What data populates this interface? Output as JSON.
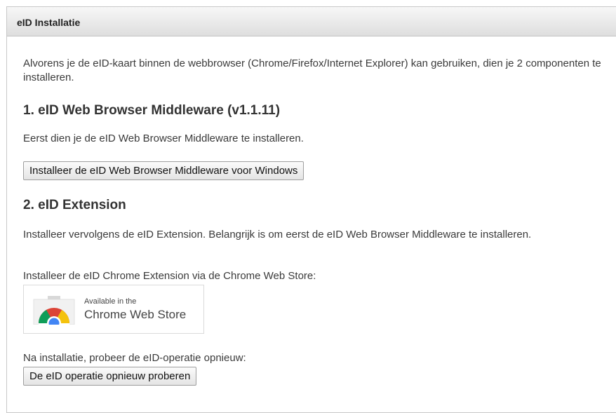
{
  "panel": {
    "title": "eID Installatie"
  },
  "intro": "Alvorens je de eID-kaart binnen de webbrowser (Chrome/Firefox/Internet Explorer) kan gebruiken, dien je 2 componenten te installeren.",
  "section1": {
    "heading": "1. eID Web Browser Middleware (v1.1.11)",
    "text": "Eerst dien je de eID Web Browser Middleware te installeren.",
    "button_label": "Installeer de eID Web Browser Middleware voor Windows"
  },
  "section2": {
    "heading": "2. eID Extension",
    "text": "Installeer vervolgens de eID Extension. Belangrijk is om eerst de eID Web Browser Middleware te installeren.",
    "store_text": "Installeer de eID Chrome Extension via de Chrome Web Store:",
    "badge": {
      "line1": "Available in the",
      "line2": "Chrome Web Store",
      "icon": "chrome-web-store-icon"
    }
  },
  "retry": {
    "text": "Na installatie, probeer de eID-operatie opnieuw:",
    "button_label": "De eID operatie opnieuw proberen"
  },
  "colors": {
    "header_gradient_top": "#f7f7f7",
    "header_gradient_bottom": "#dedede",
    "chrome_red": "#db4437",
    "chrome_yellow": "#f4c20d",
    "chrome_green": "#0f9d58",
    "chrome_blue": "#4285f4"
  }
}
